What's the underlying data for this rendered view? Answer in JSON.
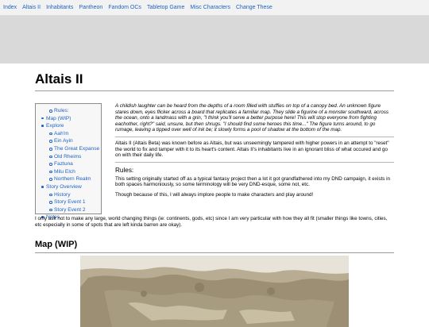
{
  "nav": {
    "items": [
      "Index",
      "Altais II",
      "Inhabitants",
      "Pantheon",
      "Fandom OCs",
      "Tabletop Game",
      "Misc Characters",
      "Change These"
    ]
  },
  "page": {
    "title": "Altais II"
  },
  "toc": {
    "rules": "Rules:",
    "map": "Map (WIP)",
    "explore": "Explore",
    "explore_items": [
      "Aah'm",
      "Ein Ayin",
      "The Great Expanse",
      "Old Rheims",
      "Faztuna",
      "Milu Elch",
      "Northern Realm"
    ],
    "story_overview": "Story Overview",
    "story_items": [
      "History",
      "Story Event 1",
      "Story Event 2"
    ],
    "notes": "Notes"
  },
  "intro": {
    "text": "A childish laughter can be heard from the depths of a room filled with stuffies on top of a canopy bed. An unknown figure stares down, eyes flicker across a board that replicates a familiar map. They slide a figurine of a monster southward, across the ocean, onto a landmass with a grin, \"I think you'll serve a better purpose here! This will stop everyone from fighting eachother, right?\" said, unsure, but then shrugs. \"I should find some heroes this time...\" The figure turns around, to go rumage, leaving a tipped over well of ink be; it slowly forms a pool of shadow at the bottom of the map."
  },
  "description": {
    "text": "Altais II (Altais Beta) was known before as Altais, but was unseemingly tampered with higher powers in an attempt to \"reset\" the world to fix and tamper with it to its heart's content. Altais II's inhabitants live in an ignorant bliss of what occured and go on with their daily life."
  },
  "rules": {
    "heading": "Rules:",
    "p1": "This setting originally started off as a typical fantasy project then a lot it got grandfathered into my DND campaign, it exists in both spaces harmoniously, so some terminology will be very DND-esque, some not, etc.",
    "p2": "Though because of this, I will always implore people to make characters and play around!",
    "p3": "I only ask not to make any large, world changing things (ie: continents, gods, etc) since I am very particular with how they all fit (smaller things like towns, cities, etc especially in some of spots that are left kinda barren are okay)."
  },
  "map": {
    "heading": "Map (WIP)"
  },
  "colors": {
    "link": "#1e63c4",
    "banner": "#d9d9d9",
    "nav_bg": "#f2f2f2"
  }
}
